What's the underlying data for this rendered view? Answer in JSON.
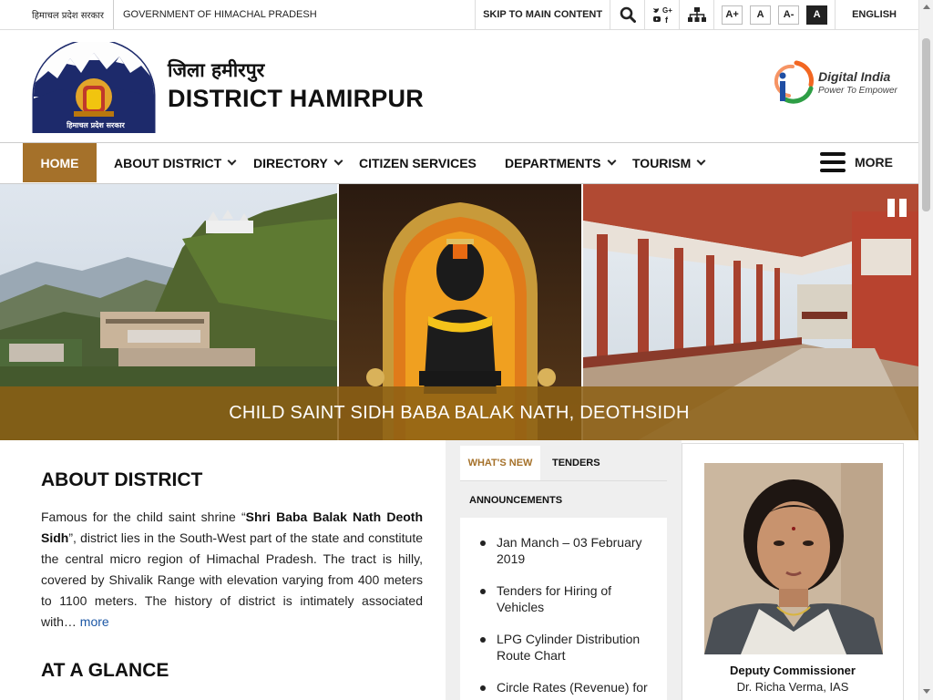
{
  "topbar": {
    "hindi_gov": "हिमाचल प्रदेश सरकार",
    "gov_name": "GOVERNMENT OF HIMACHAL PRADESH",
    "skip": "SKIP TO MAIN CONTENT",
    "font_increase": "A+",
    "font_normal": "A",
    "font_decrease": "A-",
    "contrast": "A",
    "language": "ENGLISH",
    "icons": [
      "search-icon",
      "social-media-icon",
      "sitemap-icon"
    ]
  },
  "header": {
    "hindi_title": "जिला हमीरपुर",
    "title": "DISTRICT HAMIRPUR",
    "emblem_caption": "हिमाचल प्रदेश सरकार",
    "digital_india": "Digital India",
    "digital_india_tagline": "Power To Empower"
  },
  "nav": {
    "items": [
      {
        "label": "HOME",
        "dropdown": false,
        "active": true
      },
      {
        "label": "ABOUT DISTRICT",
        "dropdown": true
      },
      {
        "label": "DIRECTORY",
        "dropdown": true
      },
      {
        "label": "CITIZEN SERVICES",
        "dropdown": false
      },
      {
        "label": "DEPARTMENTS",
        "dropdown": true
      },
      {
        "label": "TOURISM",
        "dropdown": true
      }
    ],
    "more": "MORE"
  },
  "slider": {
    "caption": "CHILD SAINT SIDH BABA BALAK NATH, DEOTHSIDH"
  },
  "about": {
    "heading": "ABOUT DISTRICT",
    "text_pre": "Famous for the child saint shrine “",
    "text_bold": "Shri Baba Balak Nath Deoth Sidh",
    "text_post": "”, district lies in the South-West part of the state and constitute the central micro region of Himachal Pradesh. The tract is hilly, covered by Shivalik Range with elevation varying from 400 meters to 1100 meters. The history of district is intimately associated with… ",
    "more_link": "more",
    "glance_heading": "AT A GLANCE"
  },
  "news": {
    "tabs": [
      "WHAT'S NEW",
      "TENDERS",
      "ANNOUNCEMENTS"
    ],
    "items": [
      "Jan Manch – 03 February 2019",
      "Tenders for Hiring of Vehicles",
      "LPG Cylinder Distribution Route Chart",
      "Circle Rates (Revenue) for"
    ]
  },
  "official": {
    "role": "Deputy Commissioner",
    "name": "Dr. Richa Verma, IAS"
  },
  "colors": {
    "accent": "#a5712a",
    "caption_bg": "#8c5f14",
    "link": "#1c57a5"
  }
}
